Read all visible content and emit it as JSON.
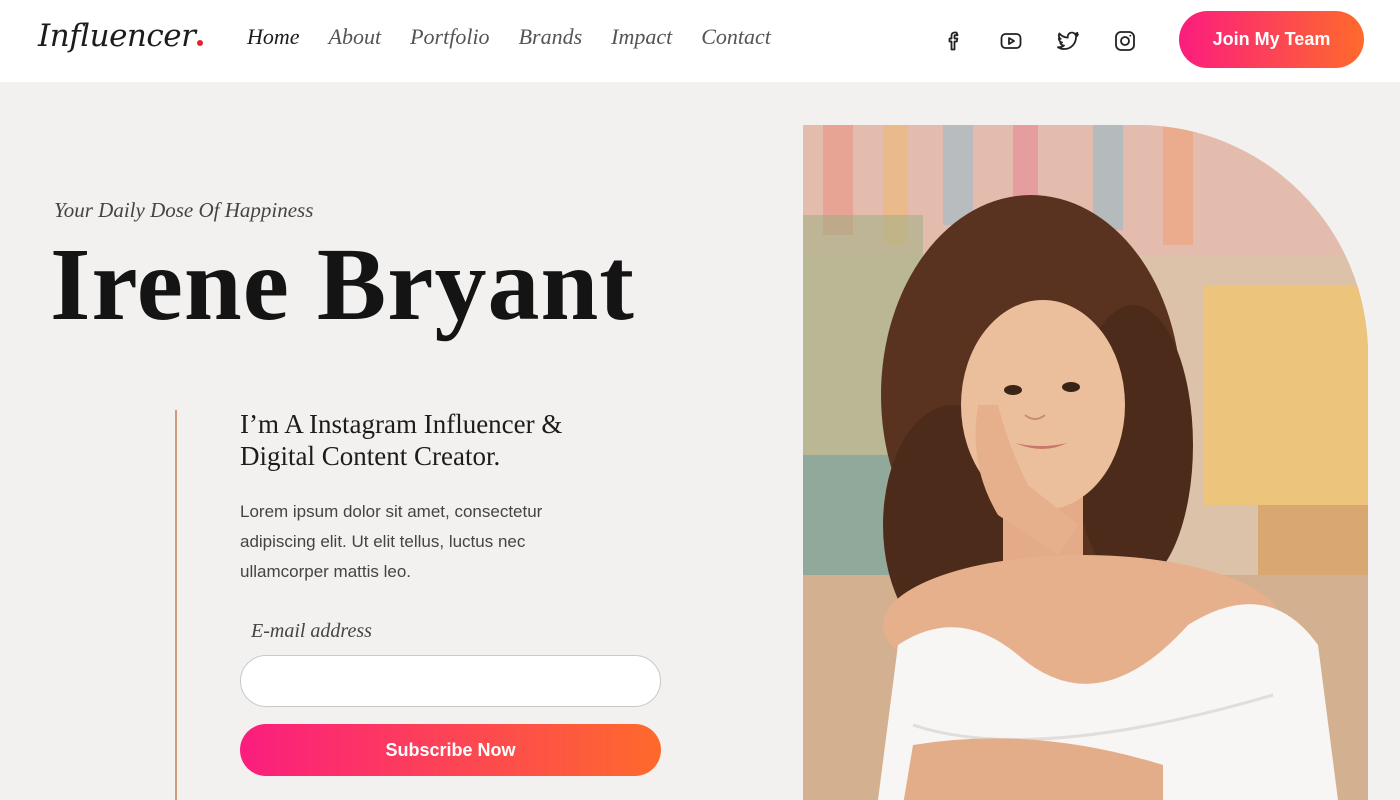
{
  "header": {
    "logo": "Influencer",
    "nav": [
      "Home",
      "About",
      "Portfolio",
      "Brands",
      "Impact",
      "Contact"
    ],
    "active_nav": "Home",
    "socials": [
      "facebook-icon",
      "youtube-icon",
      "twitter-icon",
      "instagram-icon"
    ],
    "cta_label": "Join My Team"
  },
  "hero": {
    "tagline": "Your Daily Dose Of Happiness",
    "name": "Irene Bryant",
    "subhead_line1": "I’m A Instagram Influencer &",
    "subhead_line2": "Digital Content Creator.",
    "body": "Lorem ipsum dolor sit amet, consectetur adipiscing elit. Ut elit tellus, luctus nec ullamcorper mattis leo.",
    "email_label": "E-mail address",
    "email_value": "",
    "subscribe_label": "Subscribe Now",
    "photo_icon": "portrait-photo"
  },
  "colors": {
    "accent_start": "#fb1d7e",
    "accent_end": "#fe6a2c",
    "logo_dot": "#e8232e",
    "background": "#f3f1ef"
  }
}
